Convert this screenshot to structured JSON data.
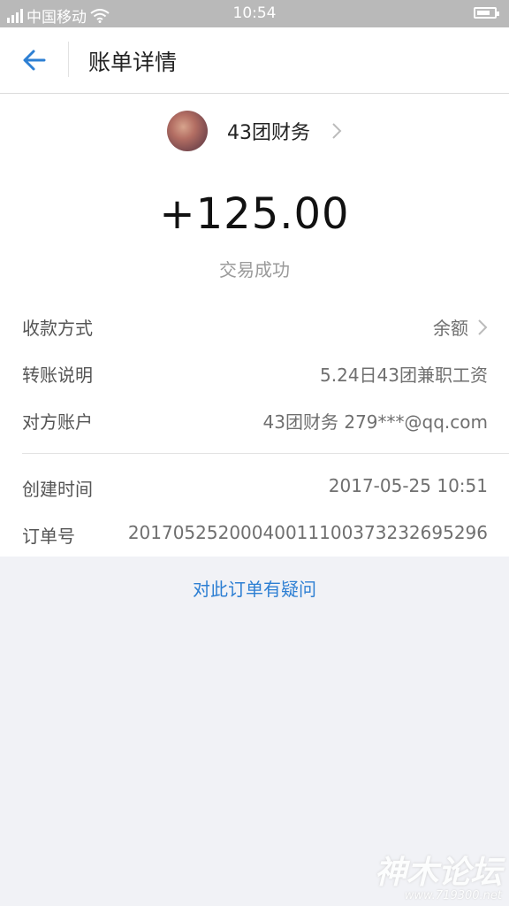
{
  "status_bar": {
    "carrier": "中国移动",
    "time": "10:54",
    "battery_level": 0.8
  },
  "header": {
    "title": "账单详情"
  },
  "payee": {
    "name": "43团财务"
  },
  "transaction": {
    "amount": "+125.00",
    "status": "交易成功"
  },
  "details": [
    {
      "label": "收款方式",
      "value": "余额"
    },
    {
      "label": "转账说明",
      "value": "5.24日43团兼职工资"
    },
    {
      "label": "对方账户",
      "value": "43团财务 279***@qq.com"
    }
  ],
  "meta": [
    {
      "label": "创建时间",
      "value": "2017-05-25 10:51"
    },
    {
      "label": "订单号",
      "value": "20170525200040011100373232695296"
    }
  ],
  "question_link": "对此订单有疑问",
  "watermark": {
    "text": "神木论坛",
    "url": "www.719300.net"
  },
  "colors": {
    "accent": "#2d7fd3",
    "status_bar": "#b9b9b9",
    "background": "#f1f2f6"
  }
}
